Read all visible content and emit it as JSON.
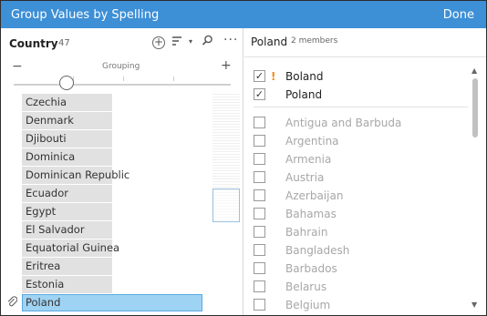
{
  "window": {
    "title": "Group Values by Spelling",
    "done_label": "Done"
  },
  "left_panel": {
    "field_name": "Country",
    "field_count": "47",
    "grouping_label": "Grouping",
    "slider_level": 0.25,
    "items": [
      {
        "label": "Czechia"
      },
      {
        "label": "Denmark"
      },
      {
        "label": "Djibouti"
      },
      {
        "label": "Dominica"
      },
      {
        "label": "Dominican Republic"
      },
      {
        "label": "Ecuador"
      },
      {
        "label": "Egypt"
      },
      {
        "label": "El Salvador"
      },
      {
        "label": "Equatorial Guinea"
      },
      {
        "label": "Eritrea"
      },
      {
        "label": "Estonia"
      },
      {
        "label": "Poland"
      }
    ],
    "selected_item": "Poland",
    "icons": {
      "add": "plus-circle-icon",
      "sort": "sort-icon",
      "dropdown": "chevron-down-icon",
      "search": "search-icon",
      "more": "more-icon",
      "zoom_out": "minus-icon",
      "zoom_in": "plus-icon",
      "attachment": "paperclip-icon"
    }
  },
  "right_panel": {
    "group_name": "Poland",
    "member_count": "2 members",
    "members": [
      {
        "label": "Boland",
        "checked": true,
        "warning": "!"
      },
      {
        "label": "Poland",
        "checked": true,
        "warning": ""
      }
    ],
    "candidates": [
      {
        "label": "Antigua and Barbuda"
      },
      {
        "label": "Argentina"
      },
      {
        "label": "Armenia"
      },
      {
        "label": "Austria"
      },
      {
        "label": "Azerbaijan"
      },
      {
        "label": "Bahamas"
      },
      {
        "label": "Bahrain"
      },
      {
        "label": "Bangladesh"
      },
      {
        "label": "Barbados"
      },
      {
        "label": "Belarus"
      },
      {
        "label": "Belgium"
      }
    ]
  },
  "colors": {
    "titlebar": "#3d8fd6",
    "selected_fill": "#9fd3f4",
    "selected_border": "#5aa9df",
    "warning": "#f18c19",
    "unselected_text": "#a7a7a7"
  }
}
